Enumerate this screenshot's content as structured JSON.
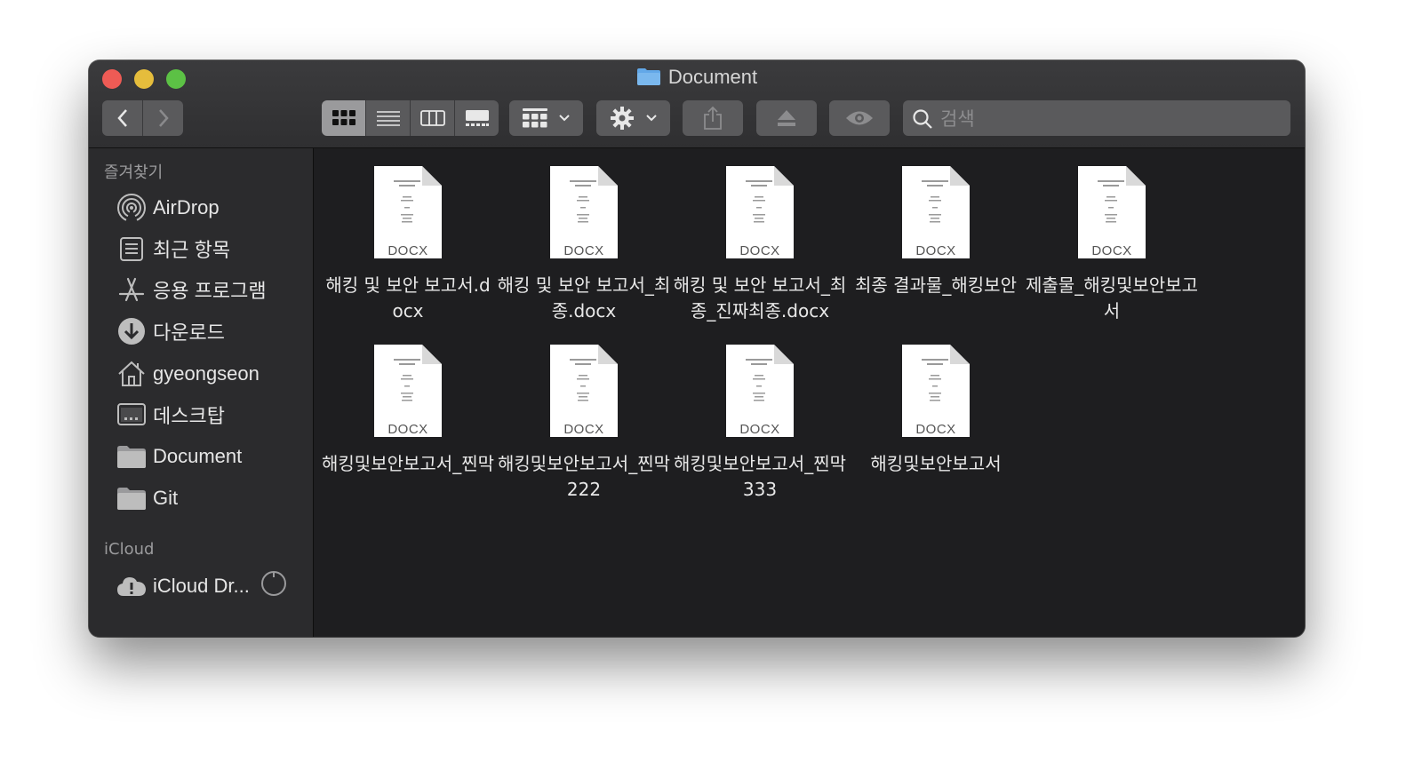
{
  "window": {
    "title": "Document"
  },
  "toolbar": {
    "search_placeholder": "검색"
  },
  "sidebar": {
    "favorites_heading": "즐겨찾기",
    "favorites": [
      {
        "label": "AirDrop",
        "icon": "airdrop-icon"
      },
      {
        "label": "최근 항목",
        "icon": "recents-icon"
      },
      {
        "label": "응용 프로그램",
        "icon": "applications-icon"
      },
      {
        "label": "다운로드",
        "icon": "downloads-icon"
      },
      {
        "label": "gyeongseon",
        "icon": "home-icon"
      },
      {
        "label": "데스크탑",
        "icon": "desktop-icon"
      },
      {
        "label": "Document",
        "icon": "folder-icon"
      },
      {
        "label": "Git",
        "icon": "folder-icon"
      }
    ],
    "icloud_heading": "iCloud",
    "icloud_items": [
      {
        "label": "iCloud Dr...",
        "icon": "icloud-warning-icon"
      }
    ]
  },
  "files": {
    "type_label": "DOCX",
    "items": [
      {
        "name": "해킹 및 보안 보고서.docx"
      },
      {
        "name": "해킹 및 보안 보고서_최종.docx"
      },
      {
        "name": "해킹 및 보안 보고서_최종_진짜최종.docx"
      },
      {
        "name": "최종 결과물_해킹보안"
      },
      {
        "name": "제출물_해킹및보안보고서"
      },
      {
        "name": "해킹및보안보고서_찐막"
      },
      {
        "name": "해킹및보안보고서_찐막222"
      },
      {
        "name": "해킹및보안보고서_찐막333"
      },
      {
        "name": "해킹및보안보고서"
      }
    ]
  },
  "colors": {
    "window_bg": "#1e1e20",
    "sidebar_bg": "#2b2b2d",
    "close": "#ee5b55",
    "minimize": "#e5bd3c",
    "maximize": "#5cc145",
    "folder_accent": "#62a8e8"
  }
}
